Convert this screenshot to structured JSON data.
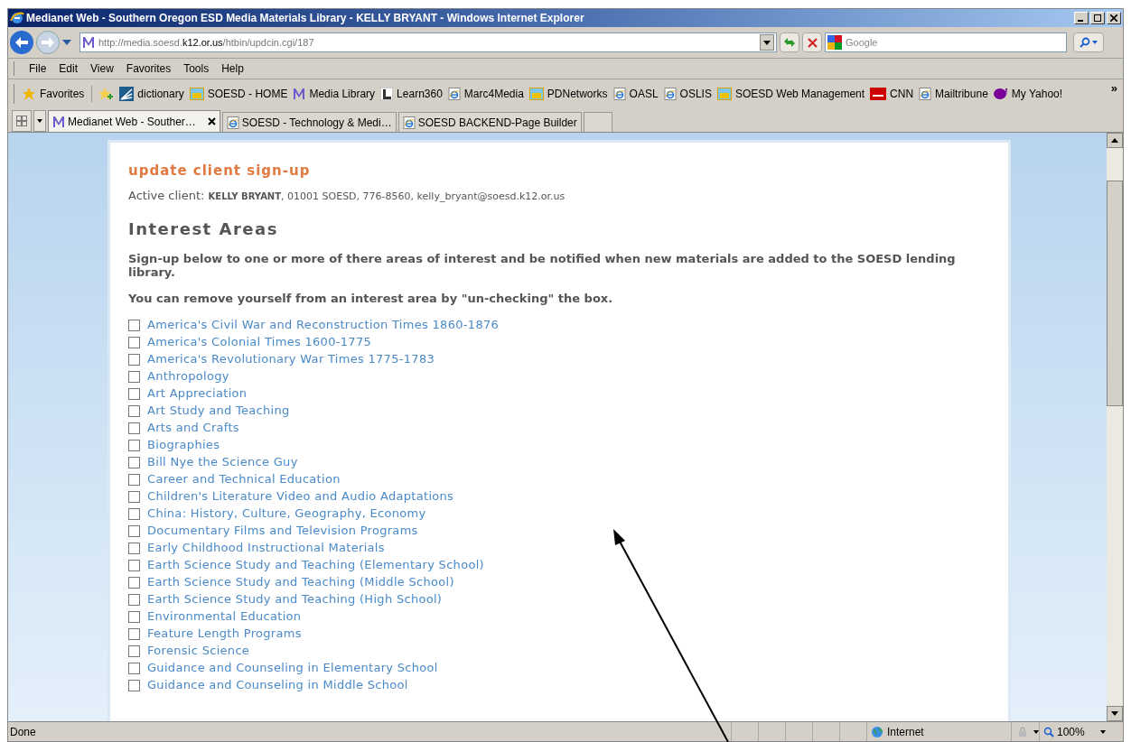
{
  "window": {
    "title": "Medianet Web - Southern Oregon ESD Media Materials Library - KELLY BRYANT - Windows Internet Explorer"
  },
  "address_bar": {
    "url_prefix": "http://media.soesd.",
    "url_domain": "k12.or.us",
    "url_path": "/htbin/updcin.cgi/187"
  },
  "search": {
    "placeholder": "Google"
  },
  "menu": [
    "File",
    "Edit",
    "View",
    "Favorites",
    "Tools",
    "Help"
  ],
  "favorites_button": "Favorites",
  "favorites_bar": [
    {
      "label": "dictionary",
      "kind": "dict"
    },
    {
      "label": "SOESD - HOME",
      "kind": "site"
    },
    {
      "label": "Media Library",
      "kind": "m"
    },
    {
      "label": "Learn360",
      "kind": "l"
    },
    {
      "label": "Marc4Media",
      "kind": "ie"
    },
    {
      "label": "PDNetworks",
      "kind": "site"
    },
    {
      "label": "OASL",
      "kind": "ie"
    },
    {
      "label": "OSLIS",
      "kind": "ie"
    },
    {
      "label": "SOESD Web Management",
      "kind": "site"
    },
    {
      "label": "CNN",
      "kind": "cnn"
    },
    {
      "label": "Mailtribune",
      "kind": "ie"
    },
    {
      "label": "My Yahoo!",
      "kind": "yahoo"
    }
  ],
  "more": "»",
  "tabs": [
    {
      "label": "Medianet Web - Souther…",
      "selected": true,
      "kind": "m"
    },
    {
      "label": "SOESD - Technology & Medi…",
      "selected": false,
      "kind": "ie"
    },
    {
      "label": "SOESD BACKEND-Page Builder",
      "selected": false,
      "kind": "ie"
    }
  ],
  "page": {
    "heading": "update client sign-up",
    "client_label": "Active client:",
    "client_name": "KELLY BRYANT",
    "client_details": ", 01001 SOESD, 776-8560, kelly_bryant@soesd.k12.or.us",
    "section_title": "Interest Areas",
    "intro": "Sign-up below to one or more of there areas of interest and be notified when new materials are added to the SOESD lending library.",
    "instruction": "You can remove yourself from an interest area by \"un-checking\" the box.",
    "interests": [
      {
        "label": "America's Civil War and Reconstruction Times 1860-1876",
        "checked": false
      },
      {
        "label": "America's Colonial Times 1600-1775",
        "checked": false
      },
      {
        "label": "America's Revolutionary War Times 1775-1783",
        "checked": false
      },
      {
        "label": "Anthropology",
        "checked": false
      },
      {
        "label": "Art Appreciation",
        "checked": false
      },
      {
        "label": "Art Study and Teaching",
        "checked": false
      },
      {
        "label": "Arts and Crafts",
        "checked": false
      },
      {
        "label": "Biographies",
        "checked": false
      },
      {
        "label": "Bill Nye the Science Guy",
        "checked": false
      },
      {
        "label": "Career and Technical Education",
        "checked": false
      },
      {
        "label": "Children's Literature Video and Audio Adaptations",
        "checked": false
      },
      {
        "label": "China: History, Culture, Geography, Economy",
        "checked": false
      },
      {
        "label": "Documentary Films and Television Programs",
        "checked": false
      },
      {
        "label": "Early Childhood Instructional Materials",
        "checked": false
      },
      {
        "label": "Earth Science Study and Teaching (Elementary School)",
        "checked": false
      },
      {
        "label": "Earth Science Study and Teaching (Middle School)",
        "checked": false
      },
      {
        "label": "Earth Science Study and Teaching (High School)",
        "checked": false
      },
      {
        "label": "Environmental Education",
        "checked": false
      },
      {
        "label": "Feature Length Programs",
        "checked": false
      },
      {
        "label": "Forensic Science",
        "checked": false
      },
      {
        "label": "Guidance and Counseling in Elementary School",
        "checked": false
      },
      {
        "label": "Guidance and Counseling in Middle School",
        "checked": false
      }
    ]
  },
  "status_bar": {
    "text": "Done",
    "zone": "Internet",
    "zoom": "100%"
  }
}
